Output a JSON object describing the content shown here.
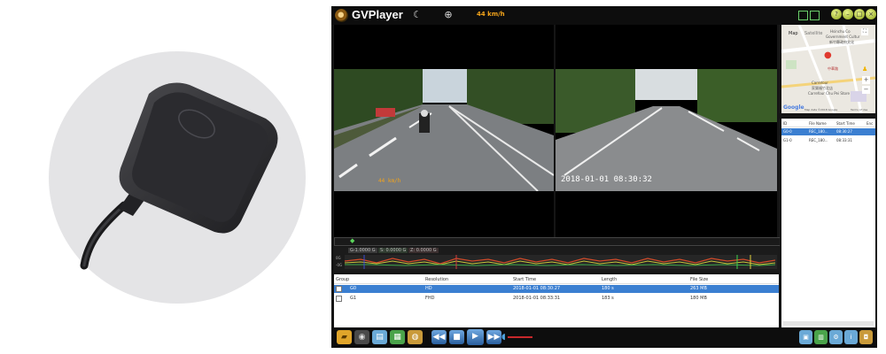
{
  "app": {
    "title": "GVPlayer",
    "speed": "44 km/h",
    "osd_timestamp": "2018-01-01 08:30:32"
  },
  "map": {
    "tab_map": "Map",
    "tab_satellite": "Satellite",
    "labels": [
      "Hsinchu Co",
      "Government Cultur",
      "新竹縣政府文化",
      "中華路",
      "Carrefour",
      "家樂福竹北店",
      "Carrefour Chu Pei Store"
    ],
    "brand": "Google",
    "footer": "Map data ©2018 Google",
    "terms": "Terms of Use",
    "zoom_in": "+",
    "zoom_out": "−"
  },
  "timeline": {
    "channels": [
      "G-1.0000 G",
      "S: 0.0000 G",
      "Z: 0.0000 G"
    ]
  },
  "table": {
    "columns": [
      "Group",
      "Resolution",
      "Start Time",
      "Length",
      "File Size"
    ],
    "rows": [
      {
        "group": "G0",
        "resolution": "HD",
        "start": "2018-01-01 08:30:27",
        "length": "180 s",
        "size": "263 MB",
        "selected": true
      },
      {
        "group": "G1",
        "resolution": "FHD",
        "start": "2018-01-01 08:33:31",
        "length": "183 s",
        "size": "180 MB",
        "selected": false
      }
    ]
  },
  "file_list": {
    "columns": [
      "ID",
      "File Name",
      "Start Time",
      "Enc"
    ],
    "rows": [
      {
        "id": "G0-0",
        "name": "REC_180...",
        "start": "08:30:27",
        "selected": true
      },
      {
        "id": "G1-0",
        "name": "REC_180...",
        "start": "08:33:31",
        "selected": false
      }
    ]
  },
  "icons": {
    "logo": "gvplayer-logo-icon",
    "bottom_left": [
      "open-folder-icon",
      "camera-icon",
      "save-icon",
      "export-icon",
      "gps-icon"
    ],
    "playback": [
      "rewind-icon",
      "stop-icon",
      "play-icon",
      "fast-forward-icon"
    ],
    "bottom_right": [
      "map-view-icon",
      "chart-icon",
      "settings-icon",
      "info-icon",
      "lock-icon"
    ]
  },
  "colors": {
    "accent": "#f2a31b",
    "selection": "#3b7fd1",
    "window_bg": "#151515"
  }
}
